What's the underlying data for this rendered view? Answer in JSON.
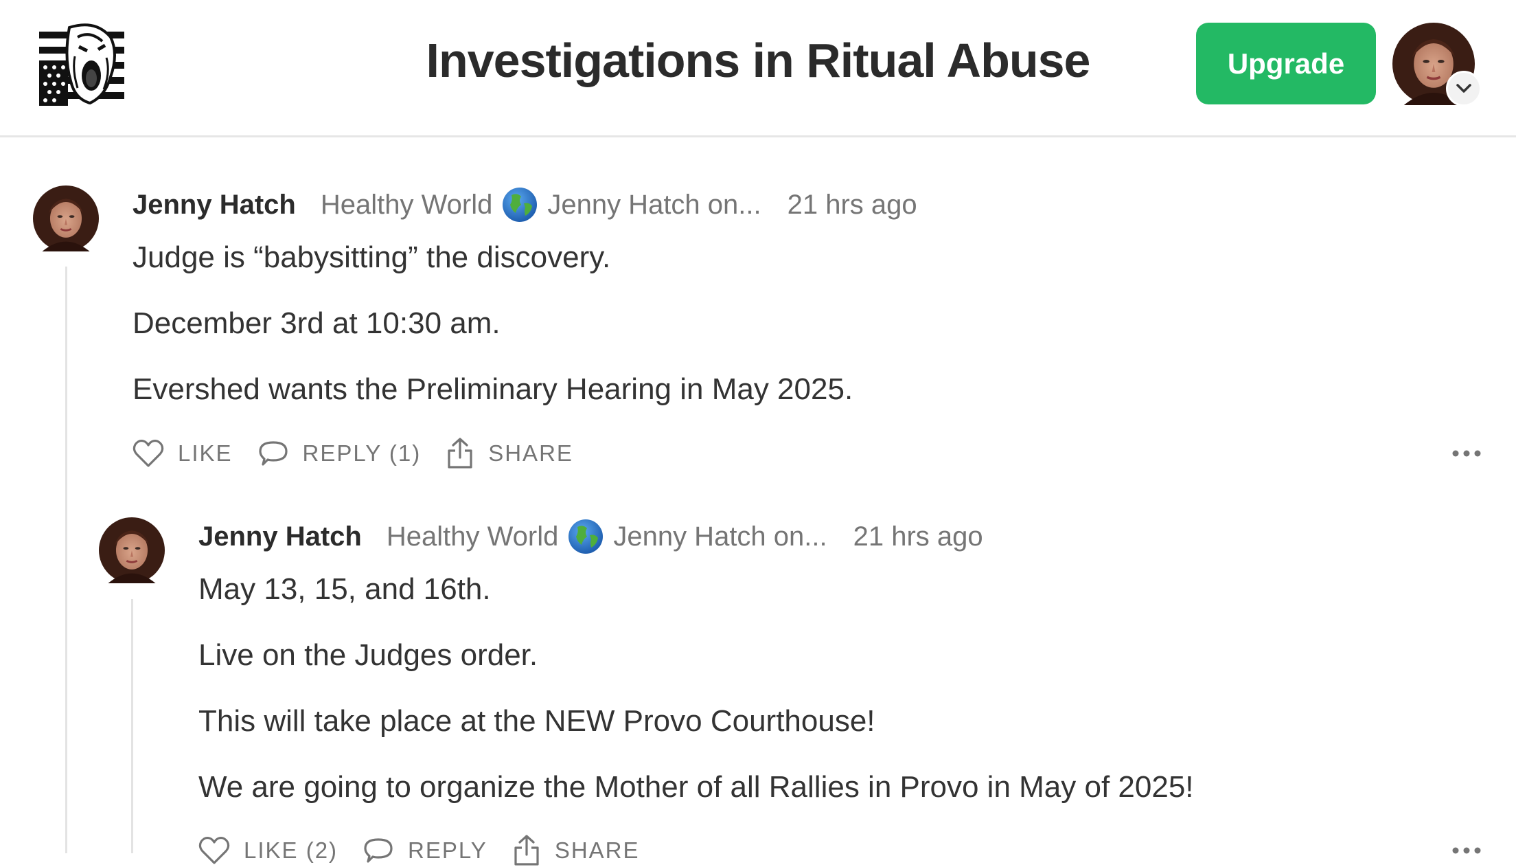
{
  "header": {
    "logo_icon": "screaming-face-flag-logo",
    "publication_title": "Investigations in Ritual Abuse",
    "upgrade_label": "Upgrade",
    "accent_color": "#23b964"
  },
  "comments": [
    {
      "author": "Jenny Hatch",
      "publication": "Healthy World",
      "globe_icon": "globe-icon",
      "publication_suffix": "Jenny Hatch on...",
      "timestamp": "21 hrs ago",
      "body": [
        "Judge is “babysitting” the discovery.",
        "December 3rd at 10:30 am.",
        "Evershed wants the Preliminary Hearing in May 2025."
      ],
      "like_label": "LIKE",
      "reply_label": "REPLY (1)",
      "share_label": "SHARE"
    },
    {
      "author": "Jenny Hatch",
      "publication": "Healthy World",
      "globe_icon": "globe-icon",
      "publication_suffix": "Jenny Hatch on...",
      "timestamp": "21 hrs ago",
      "body": [
        "May 13, 15, and 16th.",
        "Live on the Judges order.",
        "This will take place at the NEW Provo Courthouse!",
        "We are going to organize the Mother of all Rallies in Provo in May of 2025!"
      ],
      "like_label": "LIKE (2)",
      "reply_label": "REPLY",
      "share_label": "SHARE"
    }
  ]
}
